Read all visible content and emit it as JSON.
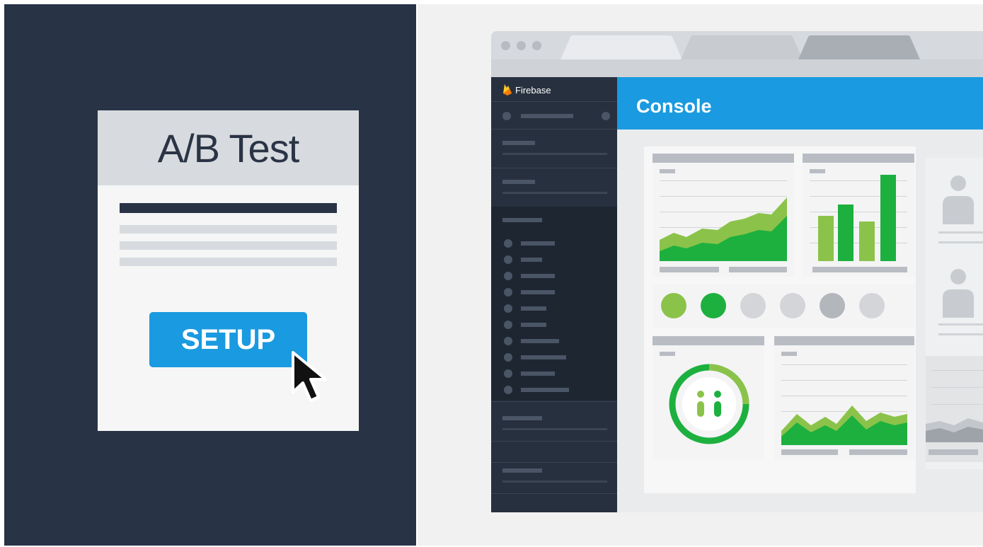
{
  "ab_card": {
    "title": "A/B Test",
    "button_label": "SETUP"
  },
  "browser": {
    "brand": "Firebase",
    "header_title": "Console"
  },
  "colors": {
    "dark_navy": "#283346",
    "accent_blue": "#1a9ae0",
    "green_primary": "#1db03f",
    "green_light": "#8bc34a",
    "gray_card": "#d7dbdf"
  },
  "icons": [
    "cursor-arrow-icon",
    "firebase-flame-icon",
    "user-avatar-icon",
    "donut-logo-icon"
  ]
}
